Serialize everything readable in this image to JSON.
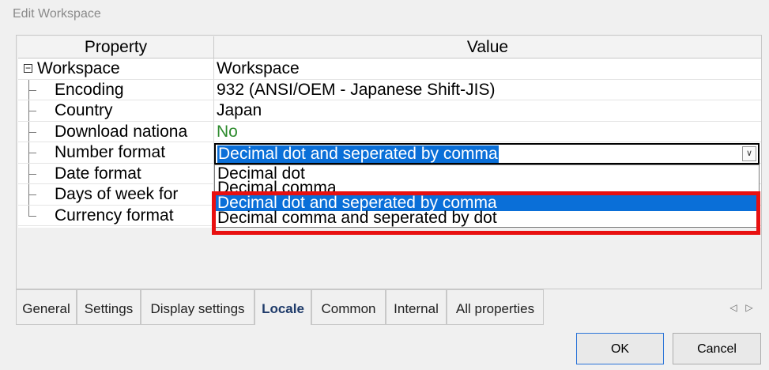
{
  "window": {
    "title": "Edit Workspace"
  },
  "grid": {
    "headers": {
      "property": "Property",
      "value": "Value"
    },
    "group": {
      "expander": "−",
      "label": "Workspace",
      "value": "Workspace"
    },
    "rows": [
      {
        "label": "Encoding",
        "value": "932   (ANSI/OEM - Japanese Shift-JIS)"
      },
      {
        "label": "Country",
        "value": "Japan"
      },
      {
        "label": "Download nationa",
        "value": "No"
      },
      {
        "label": "Number format",
        "value": "Decimal dot and seperated by comma"
      },
      {
        "label": "Date format",
        "value": ""
      },
      {
        "label": "Days of week for",
        "value": ""
      },
      {
        "label": "Currency format",
        "value": ""
      }
    ]
  },
  "number_format_dropdown": {
    "selected": "Decimal dot and seperated by comma",
    "options": [
      "Decimal dot",
      "Decimal comma",
      "Decimal dot and seperated by comma",
      "Decimal comma and seperated by dot"
    ],
    "toggle_glyph": "∨"
  },
  "tabs": [
    {
      "label": "General",
      "active": false
    },
    {
      "label": "Settings",
      "active": false
    },
    {
      "label": "Display settings",
      "active": false
    },
    {
      "label": "Locale",
      "active": true
    },
    {
      "label": "Common",
      "active": false
    },
    {
      "label": "Internal",
      "active": false
    },
    {
      "label": "All properties",
      "active": false
    }
  ],
  "tab_scroll": {
    "left_icon": "◁",
    "right_icon": "▷"
  },
  "buttons": {
    "ok": "OK",
    "cancel": "Cancel"
  },
  "colors": {
    "selection": "#0a6fd8",
    "highlight_box": "#e81010",
    "value_no": "#2e8b2e"
  }
}
